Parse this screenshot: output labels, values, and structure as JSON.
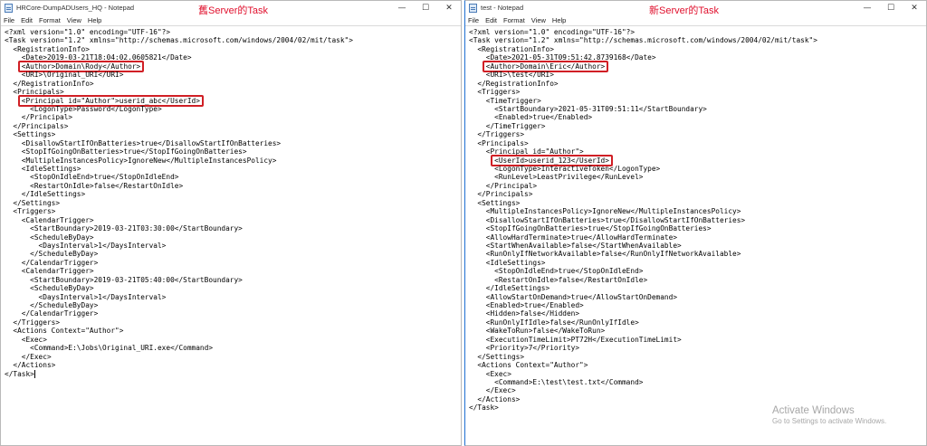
{
  "left_window": {
    "title": "HRCore-DumpADUsers_HQ - Notepad",
    "label": "舊Server的Task",
    "menu": [
      "File",
      "Edit",
      "Format",
      "View",
      "Help"
    ],
    "controls": {
      "minimize": "—",
      "maximize": "☐",
      "close": "✕"
    },
    "lines": [
      {
        "text": "<?xml version=\"1.0\" encoding=\"UTF-16\"?>"
      },
      {
        "text": "<Task version=\"1.2\" xmlns=\"http://schemas.microsoft.com/windows/2004/02/mit/task\">"
      },
      {
        "text": "  <RegistrationInfo>"
      },
      {
        "text": "    <Date>2019-03-21T18:04:02.0605821</Date>"
      },
      {
        "text": "    <Author>Domain\\Rody</Author>",
        "highlight": true
      },
      {
        "text": "    <URI>\\Original_URI</URI>"
      },
      {
        "text": "  </RegistrationInfo>"
      },
      {
        "text": "  <Principals>"
      },
      {
        "text": "    <Principal id=\"Author\">userid_abc</UserId>",
        "highlight": true
      },
      {
        "text": "      <LogonType>Password</LogonType>"
      },
      {
        "text": "    </Principal>"
      },
      {
        "text": "  </Principals>"
      },
      {
        "text": "  <Settings>"
      },
      {
        "text": "    <DisallowStartIfOnBatteries>true</DisallowStartIfOnBatteries>"
      },
      {
        "text": "    <StopIfGoingOnBatteries>true</StopIfGoingOnBatteries>"
      },
      {
        "text": "    <MultipleInstancesPolicy>IgnoreNew</MultipleInstancesPolicy>"
      },
      {
        "text": "    <IdleSettings>"
      },
      {
        "text": "      <StopOnIdleEnd>true</StopOnIdleEnd>"
      },
      {
        "text": "      <RestartOnIdle>false</RestartOnIdle>"
      },
      {
        "text": "    </IdleSettings>"
      },
      {
        "text": "  </Settings>"
      },
      {
        "text": "  <Triggers>"
      },
      {
        "text": "    <CalendarTrigger>"
      },
      {
        "text": "      <StartBoundary>2019-03-21T03:30:00</StartBoundary>"
      },
      {
        "text": "      <ScheduleByDay>"
      },
      {
        "text": "        <DaysInterval>1</DaysInterval>"
      },
      {
        "text": "      </ScheduleByDay>"
      },
      {
        "text": "    </CalendarTrigger>"
      },
      {
        "text": "    <CalendarTrigger>"
      },
      {
        "text": "      <StartBoundary>2019-03-21T05:40:00</StartBoundary>"
      },
      {
        "text": "      <ScheduleByDay>"
      },
      {
        "text": "        <DaysInterval>1</DaysInterval>"
      },
      {
        "text": "      </ScheduleByDay>"
      },
      {
        "text": "    </CalendarTrigger>"
      },
      {
        "text": "  </Triggers>"
      },
      {
        "text": "  <Actions Context=\"Author\">"
      },
      {
        "text": "    <Exec>"
      },
      {
        "text": "      <Command>E:\\Jobs\\Original_URI.exe</Command>"
      },
      {
        "text": "    </Exec>"
      },
      {
        "text": "  </Actions>"
      },
      {
        "text": "</Task>"
      }
    ]
  },
  "right_window": {
    "title": "test - Notepad",
    "label": "新Server的Task",
    "menu": [
      "File",
      "Edit",
      "Format",
      "View",
      "Help"
    ],
    "controls": {
      "minimize": "—",
      "maximize": "☐",
      "close": "✕"
    },
    "lines": [
      {
        "text": "<?xml version=\"1.0\" encoding=\"UTF-16\"?>"
      },
      {
        "text": "<Task version=\"1.2\" xmlns=\"http://schemas.microsoft.com/windows/2004/02/mit/task\">"
      },
      {
        "text": "  <RegistrationInfo>"
      },
      {
        "text": "    <Date>2021-05-31T09:51:42.8739168</Date>"
      },
      {
        "text": "    <Author>Domain\\Eric</Author>",
        "highlight": true
      },
      {
        "text": "    <URI>\\test</URI>"
      },
      {
        "text": "  </RegistrationInfo>"
      },
      {
        "text": "  <Triggers>"
      },
      {
        "text": "    <TimeTrigger>"
      },
      {
        "text": "      <StartBoundary>2021-05-31T09:51:11</StartBoundary>"
      },
      {
        "text": "      <Enabled>true</Enabled>"
      },
      {
        "text": "    </TimeTrigger>"
      },
      {
        "text": "  </Triggers>"
      },
      {
        "text": "  <Principals>"
      },
      {
        "text": "    <Principal id=\"Author\">"
      },
      {
        "text": "      <UserId>userid_123</UserId>",
        "highlight": true
      },
      {
        "text": "      <LogonType>InteractiveToken</LogonType>"
      },
      {
        "text": "      <RunLevel>LeastPrivilege</RunLevel>"
      },
      {
        "text": "    </Principal>"
      },
      {
        "text": "  </Principals>"
      },
      {
        "text": "  <Settings>"
      },
      {
        "text": "    <MultipleInstancesPolicy>IgnoreNew</MultipleInstancesPolicy>"
      },
      {
        "text": "    <DisallowStartIfOnBatteries>true</DisallowStartIfOnBatteries>"
      },
      {
        "text": "    <StopIfGoingOnBatteries>true</StopIfGoingOnBatteries>"
      },
      {
        "text": "    <AllowHardTerminate>true</AllowHardTerminate>"
      },
      {
        "text": "    <StartWhenAvailable>false</StartWhenAvailable>"
      },
      {
        "text": "    <RunOnlyIfNetworkAvailable>false</RunOnlyIfNetworkAvailable>"
      },
      {
        "text": "    <IdleSettings>"
      },
      {
        "text": "      <StopOnIdleEnd>true</StopOnIdleEnd>"
      },
      {
        "text": "      <RestartOnIdle>false</RestartOnIdle>"
      },
      {
        "text": "    </IdleSettings>"
      },
      {
        "text": "    <AllowStartOnDemand>true</AllowStartOnDemand>"
      },
      {
        "text": "    <Enabled>true</Enabled>"
      },
      {
        "text": "    <Hidden>false</Hidden>"
      },
      {
        "text": "    <RunOnlyIfIdle>false</RunOnlyIfIdle>"
      },
      {
        "text": "    <WakeToRun>false</WakeToRun>"
      },
      {
        "text": "    <ExecutionTimeLimit>PT72H</ExecutionTimeLimit>"
      },
      {
        "text": "    <Priority>7</Priority>"
      },
      {
        "text": "  </Settings>"
      },
      {
        "text": "  <Actions Context=\"Author\">"
      },
      {
        "text": "    <Exec>"
      },
      {
        "text": "      <Command>E:\\test\\test.txt</Command>"
      },
      {
        "text": "    </Exec>"
      },
      {
        "text": "  </Actions>"
      },
      {
        "text": "</Task>"
      }
    ]
  },
  "watermark": {
    "title": "Activate Windows",
    "subtitle": "Go to Settings to activate Windows."
  },
  "colors": {
    "highlight_border": "#d01f25",
    "label_red": "#e0102d",
    "window_focus": "#1f6fd1"
  }
}
